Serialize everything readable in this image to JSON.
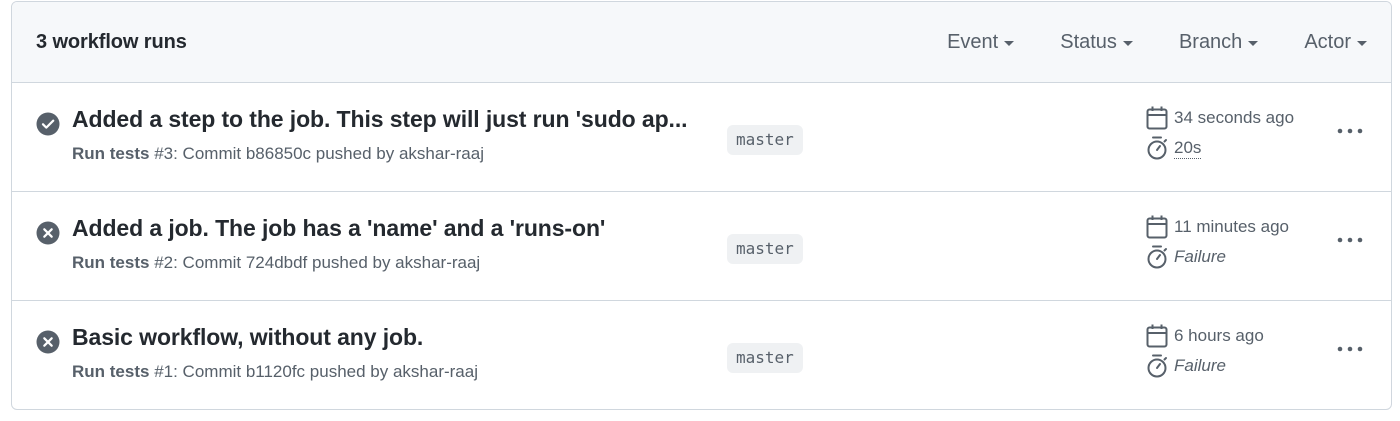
{
  "header": {
    "run_count": "3 workflow runs",
    "filters": [
      "Event",
      "Status",
      "Branch",
      "Actor"
    ]
  },
  "colors": {
    "success": "#57606a",
    "failure": "#57606a",
    "header_bg": "#f6f8fa",
    "border": "#d0d7de"
  },
  "runs": [
    {
      "status": "success",
      "status_icon": "check-circle-fill-icon",
      "title": "Added a step to the job. This step will just run 'sudo ap...",
      "workflow": "Run tests",
      "meta_rest": " #3: Commit b86850c pushed by akshar-raaj",
      "branch": "master",
      "when": "34 seconds ago",
      "duration": "20s"
    },
    {
      "status": "failure",
      "status_icon": "x-circle-fill-icon",
      "title": "Added a job. The job has a 'name' and a 'runs-on'",
      "workflow": "Run tests",
      "meta_rest": " #2: Commit 724dbdf pushed by akshar-raaj",
      "branch": "master",
      "when": "11 minutes ago",
      "duration": "Failure"
    },
    {
      "status": "failure",
      "status_icon": "x-circle-fill-icon",
      "title": "Basic workflow, without any job.",
      "workflow": "Run tests",
      "meta_rest": " #1: Commit b1120fc pushed by akshar-raaj",
      "branch": "master",
      "when": "6 hours ago",
      "duration": "Failure"
    }
  ]
}
